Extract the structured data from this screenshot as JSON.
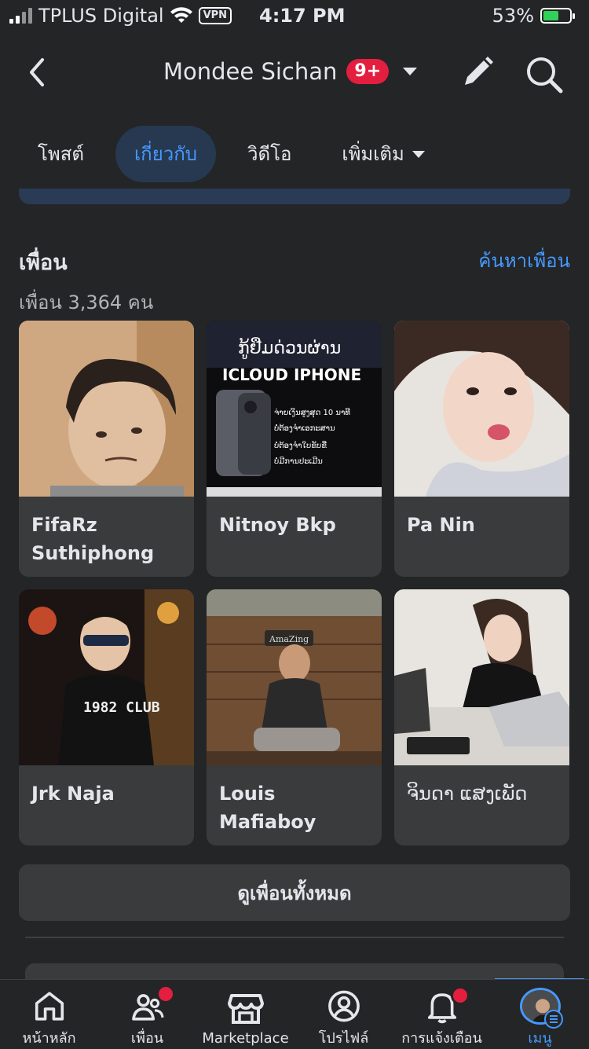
{
  "status_bar": {
    "carrier": "TPLUS Digital",
    "vpn": "VPN",
    "time": "4:17 PM",
    "battery": "53%"
  },
  "header": {
    "title": "Mondee Sichan",
    "badge": "9+"
  },
  "tabs": [
    {
      "label": "โพสต์"
    },
    {
      "label": "เกี่ยวกับ"
    },
    {
      "label": "วิดีโอ"
    },
    {
      "label": "เพิ่มเติม"
    }
  ],
  "friends": {
    "title": "เพื่อน",
    "count_text": "เพื่อน 3,364 คน",
    "find_link": "ค้นหาเพื่อน",
    "items": [
      {
        "name": "FifaRz Suthiphong"
      },
      {
        "name": "Nitnoy Bkp",
        "photo_text": {
          "headline": "ກູ້ຢືມດ່ວນຜ່ານ",
          "title": "ICLOUD IPHONE",
          "bullets": [
            "ຈ່າຍເງິນສູງສຸດ 10 ນາທີ",
            "ບໍ່ຕ້ອງຈຳເອກະສານ",
            "ບໍ່ຕ້ອງຈຳໃບຂັບຂີ່",
            "ບໍ່ມີການປະເມີນ"
          ]
        }
      },
      {
        "name": "Pa Nin"
      },
      {
        "name": "Jrk Naja",
        "shirt_text": "1982 CLUB"
      },
      {
        "name": "Louis Mafiaboy",
        "sign_text": "AmaZing"
      },
      {
        "name": "ຈິນດາ ແສງເພັດ"
      }
    ],
    "see_all": "ดูเพื่อนทั้งหมด"
  },
  "bottom_nav": [
    {
      "label": "หน้าหลัก",
      "icon": "home-icon"
    },
    {
      "label": "เพื่อน",
      "icon": "friends-icon"
    },
    {
      "label": "Marketplace",
      "icon": "marketplace-icon"
    },
    {
      "label": "โปรไฟล์",
      "icon": "profile-icon"
    },
    {
      "label": "การแจ้งเตือน",
      "icon": "bell-icon"
    },
    {
      "label": "เมนู",
      "icon": "menu-avatar"
    }
  ],
  "colors": {
    "accent": "#4599ff",
    "badge": "#e41e3f",
    "bg": "#242526",
    "card": "#3a3b3c"
  }
}
